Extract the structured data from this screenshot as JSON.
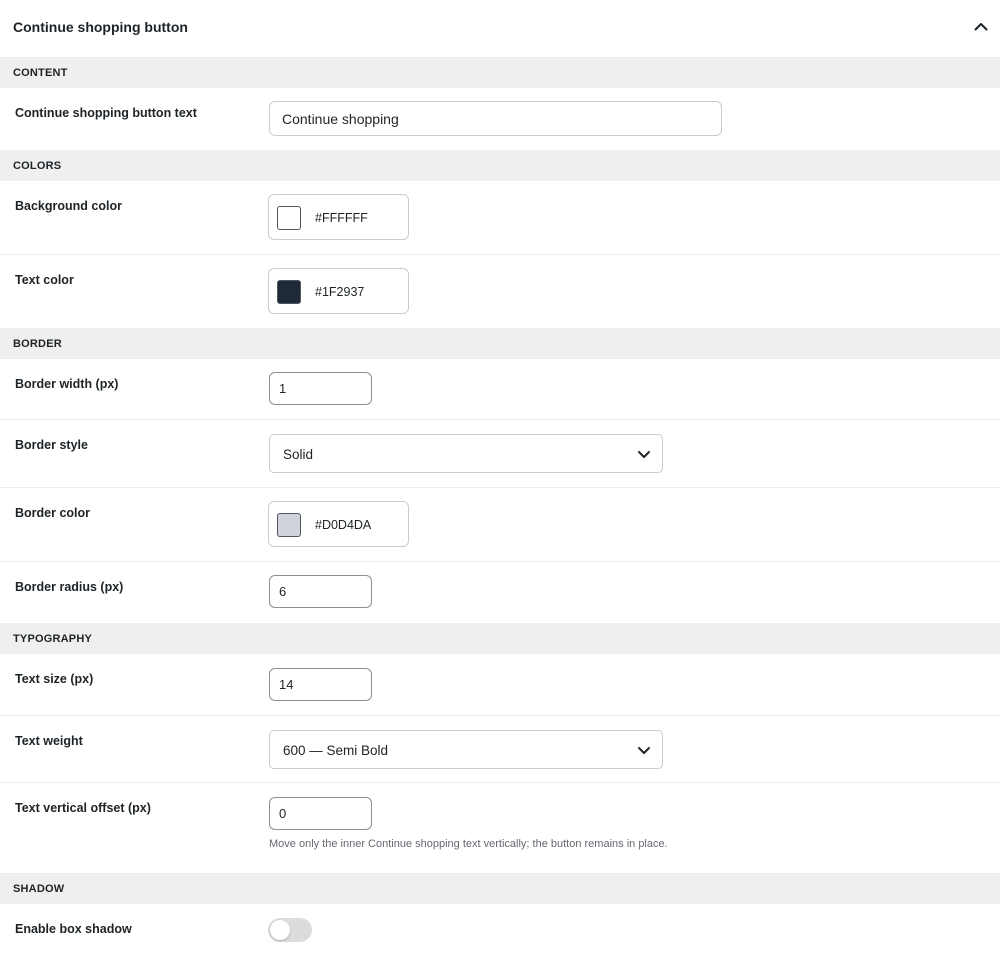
{
  "panel": {
    "title": "Continue shopping button"
  },
  "sections": {
    "content": "CONTENT",
    "colors": "COLORS",
    "border": "BORDER",
    "typography": "TYPOGRAPHY",
    "shadow": "SHADOW"
  },
  "fields": {
    "button_text": {
      "label": "Continue shopping button text",
      "value": "Continue shopping"
    },
    "background_color": {
      "label": "Background color",
      "value": "#FFFFFF",
      "swatch": "#FFFFFF"
    },
    "text_color": {
      "label": "Text color",
      "value": "#1F2937",
      "swatch": "#1F2937"
    },
    "border_width": {
      "label": "Border width (px)",
      "value": "1"
    },
    "border_style": {
      "label": "Border style",
      "value": "Solid"
    },
    "border_color": {
      "label": "Border color",
      "value": "#D0D4DA",
      "swatch": "#D0D4DA"
    },
    "border_radius": {
      "label": "Border radius (px)",
      "value": "6"
    },
    "text_size": {
      "label": "Text size (px)",
      "value": "14"
    },
    "text_weight": {
      "label": "Text weight",
      "value": "600 — Semi Bold"
    },
    "text_offset": {
      "label": "Text vertical offset (px)",
      "value": "0",
      "help": "Move only the inner Continue shopping text vertically; the button remains in place."
    },
    "box_shadow": {
      "label": "Enable box shadow",
      "enabled": false
    }
  },
  "icons": {
    "collapse": "chevron-up-icon",
    "dropdown": "chevron-down-icon"
  }
}
